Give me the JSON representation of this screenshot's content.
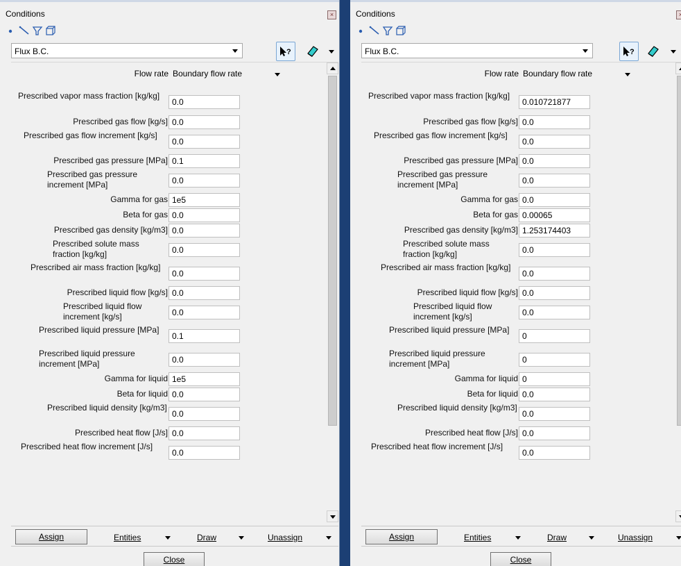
{
  "panels": [
    {
      "title": "Conditions",
      "selector": "Flux B.C.",
      "flow_rate_label": "Flow rate",
      "flow_rate_value": "Boundary flow rate",
      "fields": [
        {
          "label": "Prescribed vapor mass fraction [kg/kg]",
          "value": "0.0"
        },
        {
          "label": "Prescribed gas flow [kg/s]",
          "value": "0.0"
        },
        {
          "label": "Prescribed gas flow increment [kg/s]",
          "value": "0.0"
        },
        {
          "label": "Prescribed gas pressure [MPa]",
          "value": "0.1"
        },
        {
          "label": "Prescribed gas pressure increment [MPa]",
          "value": "0.0"
        },
        {
          "label": "Gamma for gas",
          "value": "1e5"
        },
        {
          "label": "Beta for gas",
          "value": "0.0"
        },
        {
          "label": "Prescribed gas density [kg/m3]",
          "value": "0.0"
        },
        {
          "label": "Prescribed solute mass fraction [kg/kg]",
          "value": "0.0"
        },
        {
          "label": "Prescribed air mass fraction [kg/kg]",
          "value": "0.0"
        },
        {
          "label": "Prescribed liquid flow [kg/s]",
          "value": "0.0"
        },
        {
          "label": "Prescribed liquid flow increment [kg/s]",
          "value": "0.0"
        },
        {
          "label": "Prescribed liquid pressure [MPa]",
          "value": "0.1"
        },
        {
          "label": "Prescribed liquid pressure increment [MPa]",
          "value": "0.0"
        },
        {
          "label": "Gamma for liquid",
          "value": "1e5"
        },
        {
          "label": "Beta for liquid",
          "value": "0.0"
        },
        {
          "label": "Prescribed liquid density [kg/m3]",
          "value": "0.0"
        },
        {
          "label": "Prescribed heat flow [J/s]",
          "value": "0.0"
        },
        {
          "label": "Prescribed heat flow increment [J/s]",
          "value": "0.0"
        }
      ],
      "assign_label": "Assign",
      "entities_label": "Entities",
      "draw_label": "Draw",
      "unassign_label": "Unassign",
      "close_label": "Close"
    },
    {
      "title": "Conditions",
      "selector": "Flux B.C.",
      "flow_rate_label": "Flow rate",
      "flow_rate_value": "Boundary flow rate",
      "fields": [
        {
          "label": "Prescribed vapor mass fraction [kg/kg]",
          "value": "0.010721877"
        },
        {
          "label": "Prescribed gas flow [kg/s]",
          "value": "0.0"
        },
        {
          "label": "Prescribed gas flow increment [kg/s]",
          "value": "0.0"
        },
        {
          "label": "Prescribed gas pressure [MPa]",
          "value": "0.0"
        },
        {
          "label": "Prescribed gas pressure increment [MPa]",
          "value": "0.0"
        },
        {
          "label": "Gamma for gas",
          "value": "0.0"
        },
        {
          "label": "Beta for gas",
          "value": "0.00065"
        },
        {
          "label": "Prescribed gas density [kg/m3]",
          "value": "1.253174403"
        },
        {
          "label": "Prescribed solute mass fraction [kg/kg]",
          "value": "0.0"
        },
        {
          "label": "Prescribed air mass fraction [kg/kg]",
          "value": "0.0"
        },
        {
          "label": "Prescribed liquid flow [kg/s]",
          "value": "0.0"
        },
        {
          "label": "Prescribed liquid flow increment [kg/s]",
          "value": "0.0"
        },
        {
          "label": "Prescribed liquid pressure [MPa]",
          "value": "0"
        },
        {
          "label": "Prescribed liquid pressure increment [MPa]",
          "value": "0"
        },
        {
          "label": "Gamma for liquid",
          "value": "0"
        },
        {
          "label": "Beta for liquid",
          "value": "0.0"
        },
        {
          "label": "Prescribed liquid density [kg/m3]",
          "value": "0.0"
        },
        {
          "label": "Prescribed heat flow [J/s]",
          "value": "0.0"
        },
        {
          "label": "Prescribed heat flow increment [J/s]",
          "value": "0.0"
        }
      ],
      "assign_label": "Assign",
      "entities_label": "Entities",
      "draw_label": "Draw",
      "unassign_label": "Unassign",
      "close_label": "Close"
    }
  ],
  "icons": {
    "toolbar": [
      "point-icon",
      "line-icon",
      "surface-icon",
      "volume-icon"
    ],
    "help": "help-pointer-icon",
    "erase": "eraser-icon",
    "close": "window-close-icon"
  },
  "colors": {
    "background": "#1c3f74",
    "panel": "#f0f0f0",
    "toolbar_blue": "#2a5db0"
  }
}
